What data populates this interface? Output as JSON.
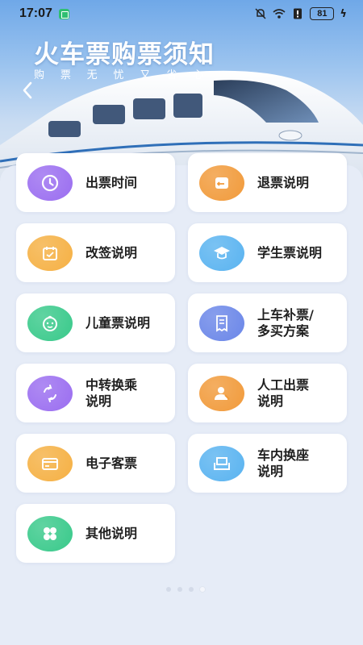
{
  "status_bar": {
    "time": "17:07",
    "battery": "81"
  },
  "hero": {
    "title": "火车票购票须知",
    "subtitle_chars": [
      "购",
      "票",
      "无",
      "忧",
      "又",
      "省",
      "心"
    ]
  },
  "cards": [
    {
      "label": "出票时间",
      "icon": "clock-icon",
      "color": "#9a6df0"
    },
    {
      "label": "退票说明",
      "icon": "refund-ticket-icon",
      "color": "#f19a3a"
    },
    {
      "label": "改签说明",
      "icon": "calendar-icon",
      "color": "#f5b043"
    },
    {
      "label": "学生票说明",
      "icon": "graduation-cap-icon",
      "color": "#59b3f0"
    },
    {
      "label": "儿童票说明",
      "icon": "child-face-icon",
      "color": "#38c98a"
    },
    {
      "label": "上车补票/\n多买方案",
      "icon": "receipt-icon",
      "color": "#6a86e8"
    },
    {
      "label": "中转换乘\n说明",
      "icon": "transfer-icon",
      "color": "#9a6df0"
    },
    {
      "label": "人工出票\n说明",
      "icon": "agent-icon",
      "color": "#f19a3a"
    },
    {
      "label": "电子客票",
      "icon": "card-icon",
      "color": "#f5b043"
    },
    {
      "label": "车内换座\n说明",
      "icon": "seat-icon",
      "color": "#59b3f0"
    },
    {
      "label": "其他说明",
      "icon": "clover-icon",
      "color": "#38c98a"
    }
  ],
  "pagination": {
    "total": 4,
    "active": 3
  }
}
